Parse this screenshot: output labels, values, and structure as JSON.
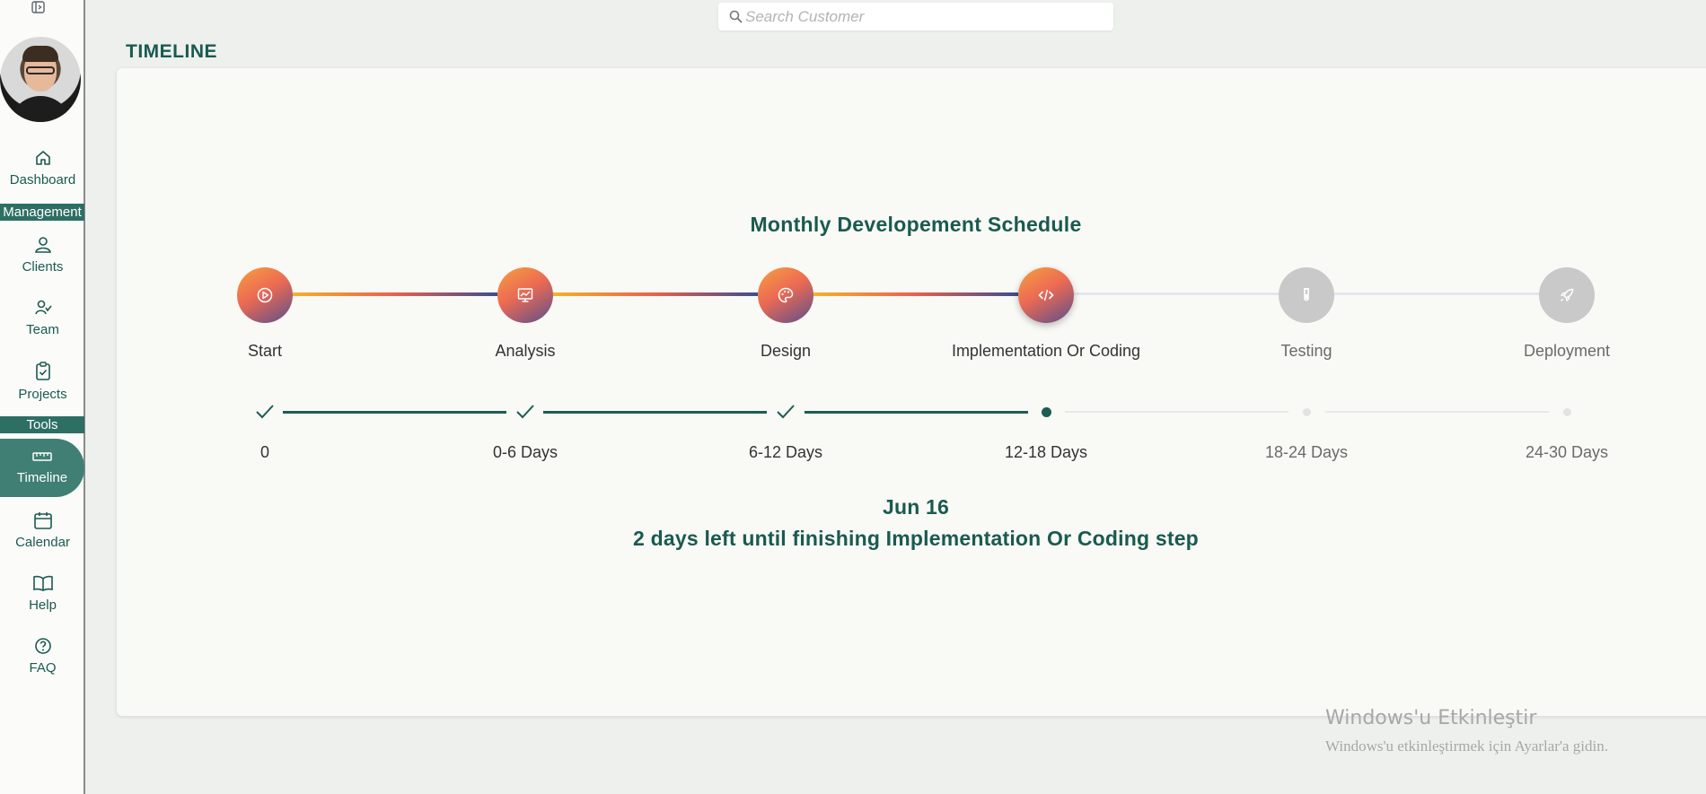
{
  "sidebar": {
    "items": [
      {
        "label": "Dashboard",
        "icon": "home-icon"
      },
      {
        "label": "Clients",
        "icon": "users-icon"
      },
      {
        "label": "Team",
        "icon": "team-icon"
      },
      {
        "label": "Projects",
        "icon": "clipboard-icon"
      },
      {
        "label": "Timeline",
        "icon": "ruler-icon",
        "active": true
      },
      {
        "label": "Calendar",
        "icon": "calendar-icon"
      },
      {
        "label": "Help",
        "icon": "book-icon"
      },
      {
        "label": "FAQ",
        "icon": "question-icon"
      }
    ],
    "sections": {
      "management": "Management",
      "tools": "Tools"
    }
  },
  "header": {
    "search_placeholder": "Search Customer",
    "page_title": "TIMELINE"
  },
  "schedule": {
    "title": "Monthly Developement Schedule",
    "steps": [
      {
        "label": "Start",
        "icon": "play-icon",
        "status": "done"
      },
      {
        "label": "Analysis",
        "icon": "monitor-chart-icon",
        "status": "done"
      },
      {
        "label": "Design",
        "icon": "palette-icon",
        "status": "done"
      },
      {
        "label": "Implementation Or Coding",
        "icon": "code-icon",
        "status": "current"
      },
      {
        "label": "Testing",
        "icon": "test-tube-icon",
        "status": "todo"
      },
      {
        "label": "Deployment",
        "icon": "rocket-icon",
        "status": "todo"
      }
    ],
    "ranges": [
      "0",
      "0-6 Days",
      "6-12 Days",
      "12-18 Days",
      "18-24 Days",
      "24-30 Days"
    ],
    "date": "Jun 16",
    "status": "2 days left until finishing Implementation Or Coding step"
  },
  "watermark": {
    "title": "Windows'u Etkinleştir",
    "subtitle": "Windows'u etkinleştirmek için Ayarlar'a gidin."
  },
  "colors": {
    "accent": "#1a5a4f",
    "active_nav": "#3f7f74",
    "gradient_start": "#f2b32b",
    "gradient_mid": "#e7614d",
    "gradient_end": "#3c4d8c"
  }
}
